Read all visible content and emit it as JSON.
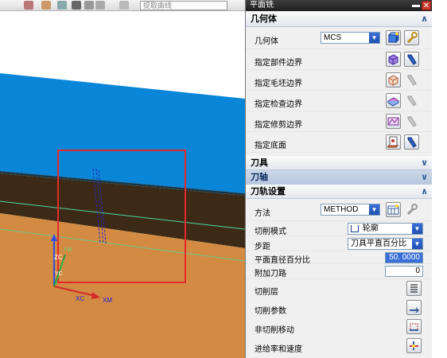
{
  "toolbar": {
    "filter_text": "提取曲线"
  },
  "viewport": {
    "axis_labels": {
      "zc": "ZC",
      "yc": "YC",
      "xc": "XC",
      "xm": "XM",
      "ym": "YM"
    },
    "colors": {
      "top_face": "#0a86d8",
      "middle_face": "#3c2a16",
      "bottom_face": "#d38a43",
      "selection_box": "#e22a2a",
      "tool_path": "#2b2bb8"
    }
  },
  "dialog": {
    "title": "平面铣",
    "geometry_section": {
      "title": "几何体",
      "chevron": "∧"
    },
    "geometry_row": {
      "label": "几何体",
      "value": "MCS"
    },
    "geometry_items": [
      {
        "label": "指定部件边界"
      },
      {
        "label": "指定毛坯边界"
      },
      {
        "label": "指定检查边界"
      },
      {
        "label": "指定修剪边界"
      },
      {
        "label": "指定底面"
      }
    ],
    "tool_section": {
      "title": "刀具",
      "chevron": "∨"
    },
    "axis_section": {
      "title": "刀轴",
      "chevron": "∨"
    },
    "path_section": {
      "title": "刀轨设置",
      "chevron": "∧"
    },
    "method_row": {
      "label": "方法",
      "value": "METHOD"
    },
    "cut_mode": {
      "label": "切削模式",
      "value": "轮廓"
    },
    "stepover": {
      "label": "步距",
      "value": "刀具平直百分比"
    },
    "flat_diameter": {
      "label": "平面直径百分比",
      "value": "50. 0000"
    },
    "extra_passes": {
      "label": "附加刀路",
      "value": "0"
    },
    "actions": [
      {
        "label": "切削层"
      },
      {
        "label": "切削参数"
      },
      {
        "label": "非切削移动"
      },
      {
        "label": "进给率和速度"
      }
    ]
  }
}
